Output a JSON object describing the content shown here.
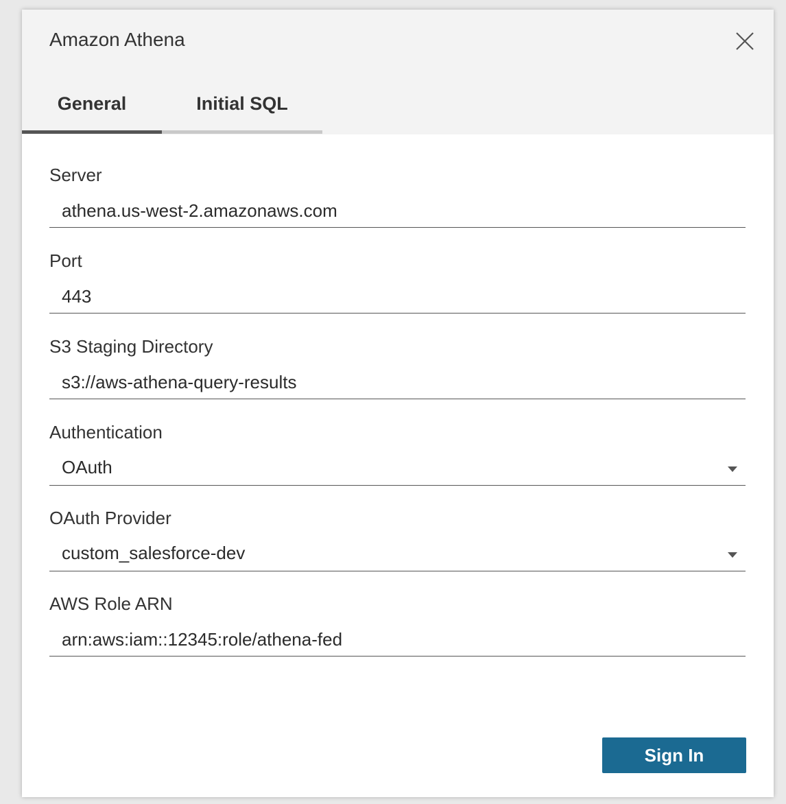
{
  "dialog": {
    "title": "Amazon Athena"
  },
  "tabs": [
    {
      "label": "General",
      "active": true
    },
    {
      "label": "Initial SQL",
      "active": false
    }
  ],
  "fields": {
    "server": {
      "label": "Server",
      "value": "athena.us-west-2.amazonaws.com"
    },
    "port": {
      "label": "Port",
      "value": "443"
    },
    "s3_staging": {
      "label": "S3 Staging Directory",
      "value": "s3://aws-athena-query-results"
    },
    "authentication": {
      "label": "Authentication",
      "value": "OAuth"
    },
    "oauth_provider": {
      "label": "OAuth Provider",
      "value": "custom_salesforce-dev"
    },
    "aws_role_arn": {
      "label": "AWS Role ARN",
      "value": "arn:aws:iam::12345:role/athena-fed"
    }
  },
  "actions": {
    "sign_in_label": "Sign In"
  },
  "colors": {
    "accent": "#1b6a92",
    "header_bg": "#f3f3f3"
  }
}
